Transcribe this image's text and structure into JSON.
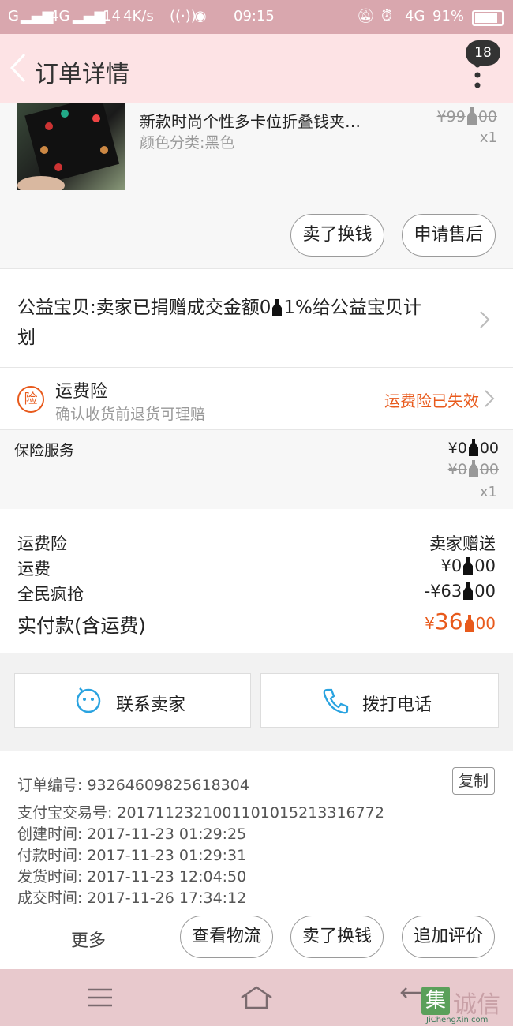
{
  "status_bar": {
    "carrier": "G",
    "network1": "4G",
    "speed": "14",
    "speed_unit": "4K/s",
    "time": "09:15",
    "network2": "4G",
    "battery": "91%"
  },
  "header": {
    "title": "订单详情",
    "badge_count": "18"
  },
  "product": {
    "name": "新款时尚个性多卡位折叠钱夹…",
    "variant": "颜色分类:黑色",
    "original_price": "¥99",
    "original_price_cents": "00",
    "quantity": "x1",
    "sell_button": "卖了换钱",
    "aftersale_button": "申请售后"
  },
  "charity": {
    "text_line1": "公益宝贝:卖家已捐赠成交金额0",
    "text_line1_tail": "1%给公益宝贝计",
    "text_line2": "划"
  },
  "insurance": {
    "icon_text": "险",
    "title": "运费险",
    "subtitle": "确认收货前退货可理赔",
    "status": "运费险已失效"
  },
  "insurance_service": {
    "label": "保险服务",
    "price": "¥0",
    "price_cents": "00",
    "original_price": "¥0",
    "original_price_cents": "00",
    "quantity": "x1"
  },
  "summary": {
    "rows": [
      {
        "label": "运费险",
        "value": "卖家赠送"
      },
      {
        "label": "运费",
        "value": "¥0",
        "cents": "00"
      },
      {
        "label": "全民疯抢",
        "value": "-¥63",
        "cents": "00"
      }
    ],
    "total_label": "实付款(含运费)",
    "total_currency": "¥",
    "total_value": "36",
    "total_cents": "00"
  },
  "contact": {
    "seller_label": "联系卖家",
    "phone_label": "拨打电话"
  },
  "order_info": {
    "copy_label": "复制",
    "lines": [
      "订单编号: 93264609825618304",
      "支付宝交易号: 2017112321001101015213316772",
      "创建时间: 2017-11-23 01:29:25",
      "付款时间: 2017-11-23 01:29:31",
      "发货时间: 2017-11-23 12:04:50",
      "成交时间: 2017-11-26 17:34:12"
    ]
  },
  "bottom_bar": {
    "more": "更多",
    "logistics": "查看物流",
    "sell": "卖了换钱",
    "review": "追加评价"
  },
  "watermark": {
    "text": "诚信",
    "url": "JiChengXin.com"
  },
  "colors": {
    "status_bar": "#d9a7ae",
    "header": "#fde3e5",
    "accent_orange": "#e85a1c",
    "nav_bar": "#e8c9cd"
  }
}
